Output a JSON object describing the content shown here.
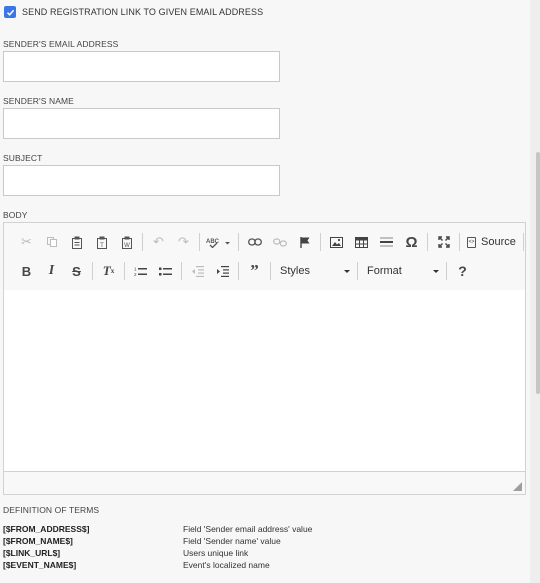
{
  "form": {
    "send_link_checkbox": {
      "checked": true,
      "label": "SEND REGISTRATION LINK TO GIVEN EMAIL ADDRESS"
    },
    "sender_email": {
      "label": "SENDER'S EMAIL ADDRESS",
      "value": ""
    },
    "sender_name": {
      "label": "SENDER'S NAME",
      "value": ""
    },
    "subject": {
      "label": "SUBJECT",
      "value": ""
    },
    "body": {
      "label": "BODY",
      "value": ""
    }
  },
  "editor": {
    "toolbar": {
      "source_label": "Source",
      "styles_label": "Styles",
      "format_label": "Format",
      "help_glyph": "?"
    }
  },
  "definitions": {
    "title": "DEFINITION OF TERMS",
    "terms": [
      {
        "key": "[$FROM_ADDRESS$]",
        "value": "Field 'Sender email address' value"
      },
      {
        "key": "[$FROM_NAME$]",
        "value": "Field 'Sender name' value"
      },
      {
        "key": "[$LINK_URL$]",
        "value": "Users unique link"
      },
      {
        "key": "[$EVENT_NAME$]",
        "value": "Event's localized name"
      }
    ]
  },
  "colors": {
    "checkbox_accent": "#3b76e6",
    "page_background": "#f7f7f7",
    "toolbar_background": "#f8f8f8"
  }
}
